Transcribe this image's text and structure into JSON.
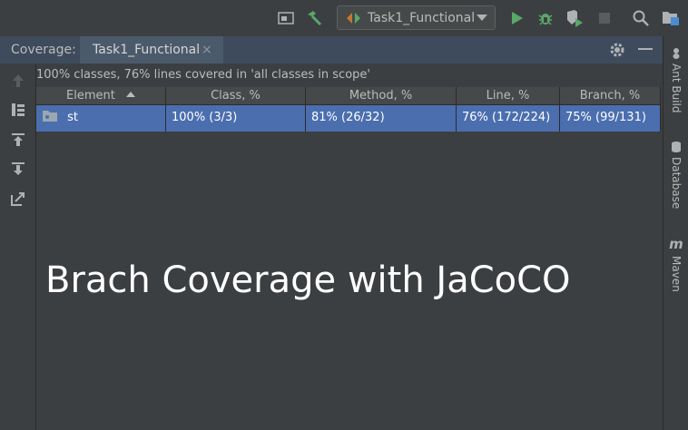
{
  "toolbar": {
    "run_config": "Task1_Functional",
    "icons": [
      "frame-icon",
      "hammer-icon",
      "run-icon",
      "debug-icon",
      "coverage-run-icon",
      "stop-icon",
      "search-icon",
      "project-structure-icon"
    ]
  },
  "tool_window": {
    "title": "Coverage:",
    "tab_label": "Task1_Functional",
    "tab_close": "×"
  },
  "summary": "100% classes, 76% lines covered in 'all classes in scope'",
  "table": {
    "columns": [
      "Element",
      "Class, %",
      "Method, %",
      "Line, %",
      "Branch, %"
    ],
    "rows": [
      {
        "element": "st",
        "class": "100% (3/3)",
        "method": "81% (26/32)",
        "line": "76% (172/224)",
        "branch": "75% (99/131)"
      }
    ]
  },
  "right_tabs": [
    "Ant Build",
    "Database",
    "Maven"
  ],
  "overlay_text": "Brach Coverage with JaCoCO",
  "colors": {
    "accent_selection": "#4b6eaf",
    "run_green": "#59a869",
    "background": "#3c3f41"
  }
}
